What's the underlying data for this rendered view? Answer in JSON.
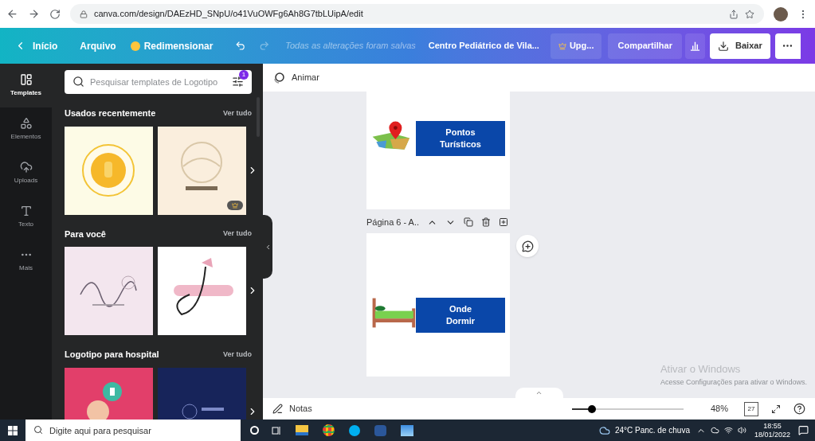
{
  "browser": {
    "url": "canva.com/design/DAEzHD_SNpU/o41VuOWFg6Ah8G7tbLUipA/edit"
  },
  "toolbar": {
    "home": "Início",
    "file": "Arquivo",
    "resize": "Redimensionar",
    "save_status": "Todas as alterações foram salvas",
    "design_title": "Centro Pediátrico de Vila...",
    "upgrade": "Upg...",
    "share": "Compartilhar",
    "download": "Baixar"
  },
  "rail": [
    {
      "label": "Templates",
      "selected": true
    },
    {
      "label": "Elementos",
      "selected": false
    },
    {
      "label": "Uploads",
      "selected": false
    },
    {
      "label": "Texto",
      "selected": false
    },
    {
      "label": "Mais",
      "selected": false
    }
  ],
  "panel": {
    "search_placeholder": "Pesquisar templates de Logotipo",
    "filter_badge": "1",
    "sections": [
      {
        "title": "Usados recentemente",
        "link": "Ver tudo",
        "thumbs": [
          {
            "kind": "picture",
            "premium": false
          },
          {
            "kind": "picture",
            "premium": true
          }
        ]
      },
      {
        "title": "Para você",
        "link": "Ver tudo",
        "thumbs": [
          {
            "kind": "picture",
            "premium": false
          },
          {
            "kind": "picture",
            "premium": false
          }
        ]
      },
      {
        "title": "Logotipo para hospital",
        "link": "Ver tudo",
        "thumbs": [
          {
            "kind": "picture"
          },
          {
            "kind": "picture"
          }
        ]
      }
    ]
  },
  "canvas": {
    "animate": "Animar",
    "pages": [
      {
        "kind": "map",
        "label": "Pontos\nTurísticos"
      },
      {
        "header": "Página 6 - A..",
        "kind": "bed",
        "label": "Onde\nDormir"
      }
    ]
  },
  "os_notice": {
    "title": "Ativar o Windows",
    "subtitle": "Acesse Configurações para ativar o Windows."
  },
  "footer": {
    "notes": "Notas",
    "zoom": {
      "level": 0.18,
      "reading": "48%"
    },
    "page_count": "27"
  },
  "taskbar": {
    "search_placeholder": "Digite aqui para pesquisar",
    "weather": "24°C Panc. de chuva",
    "time": "18:55",
    "date": "18/01/2022"
  }
}
